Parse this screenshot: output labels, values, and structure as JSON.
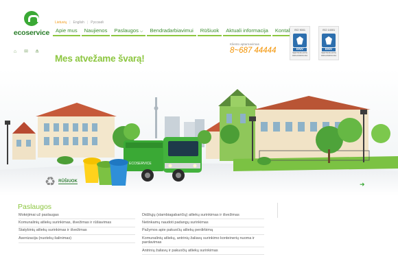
{
  "logo": {
    "name": "ecoservice"
  },
  "languages": [
    "Lietuvių",
    "English",
    "Русский"
  ],
  "nav": {
    "items": [
      {
        "label": "Apie mus"
      },
      {
        "label": "Naujienos"
      },
      {
        "label": "Paslaugos",
        "has_dropdown": true
      },
      {
        "label": "Bendradarbiavimui"
      },
      {
        "label": "Rūšiuok"
      },
      {
        "label": "Aktuali informacija"
      },
      {
        "label": "Kontaktai"
      }
    ]
  },
  "tagline": "Mes atvežame švarą!",
  "contact": {
    "label": "Kliento aptarnavimas",
    "phone": "8~687 44444"
  },
  "badges": [
    {
      "top": "ISO 9001",
      "brand": "DNV",
      "sub1": "SERTIFIKUOTA",
      "sub2": "ORGANIZACIJA"
    },
    {
      "top": "ISO 14001",
      "brand": "DNV",
      "sub1": "SERTIFIKUOTA",
      "sub2": "ORGANIZACIJA"
    }
  ],
  "hero": {
    "truck_text": "ECOSERVICE",
    "promo_label": "RŪŠIUOK"
  },
  "services": {
    "title": "Paslaugos",
    "left": [
      "Mokėjimai už paslaugas",
      "Komunalinių atliekų surinkimas, išvežimas ir rūšiavimas",
      "Statybinių atliekų surinkimas ir išvežimas",
      "Asenizacija (nuotekų šalinimas)"
    ],
    "right": [
      "Didžiųjų (stambiagabaričių) atliekų surinkimas ir išvežimas",
      "Netinkamų naudoti padangų surinkimas",
      "Pažymos apie pakuočių atliekų perdirbimą",
      "Komunalinių atliekų, antrinių žaliavų surinkimo konteinerių nuoma ir pardavimas",
      "Antrinių žaliavų ir pakuočių atliekų surinkimas"
    ]
  },
  "colors": {
    "brand_green": "#3aa935",
    "light_green": "#8cc63f",
    "accent_orange": "#f39200",
    "dnv_blue": "#2d6fae"
  },
  "icons": [
    "home-icon",
    "mail-icon",
    "sitemap-icon",
    "recycle-icon",
    "arrow-right-icon"
  ]
}
